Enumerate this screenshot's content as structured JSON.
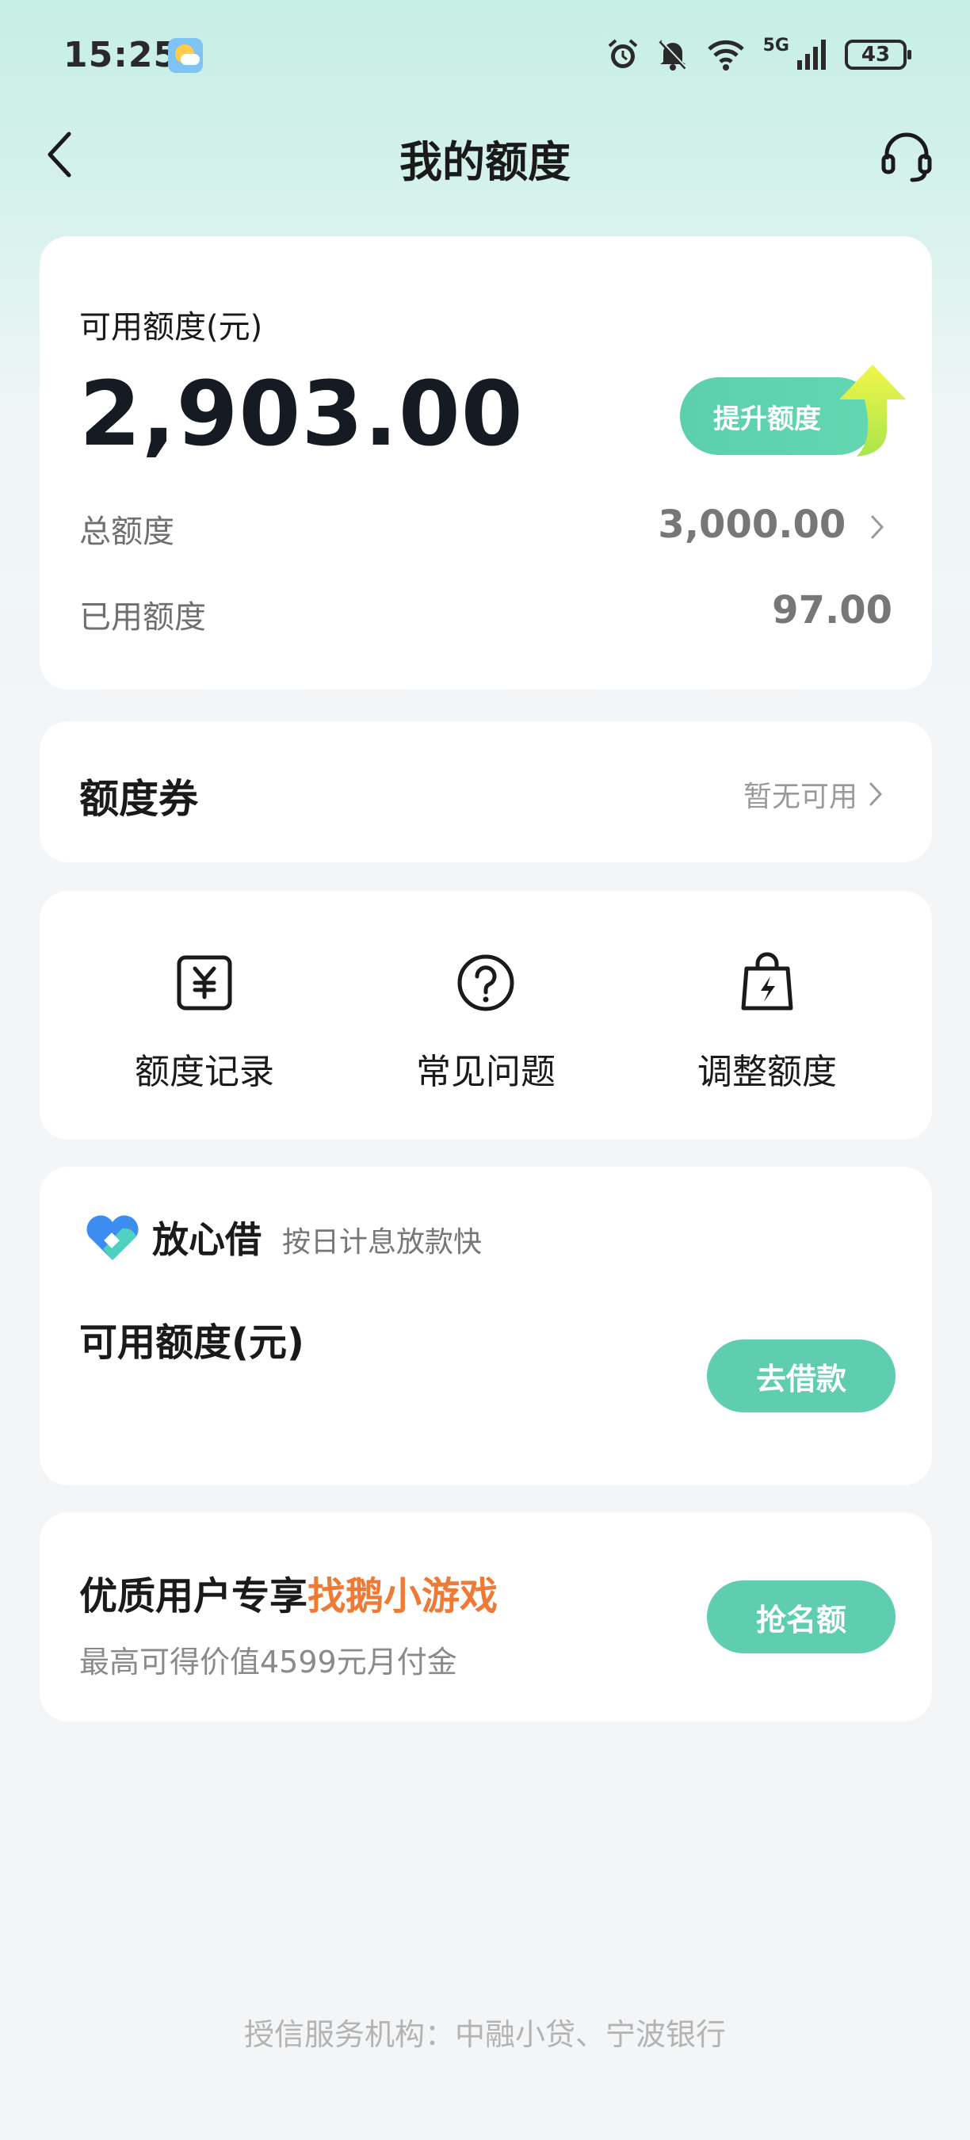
{
  "status_bar": {
    "time": "15:25",
    "weather_icon": "sun-cloud-icon",
    "network": "5G",
    "battery": "43"
  },
  "nav": {
    "title": "我的额度",
    "back_icon": "chevron-left-icon",
    "service_icon": "headset-icon"
  },
  "quota": {
    "label": "可用额度(元)",
    "amount": "2,903.00",
    "raise_button": "提升额度",
    "total_label": "总额度",
    "total_value": "3,000.00",
    "used_label": "已用额度",
    "used_value": "97.00"
  },
  "coupon": {
    "title": "额度券",
    "status": "暂无可用"
  },
  "functions": [
    {
      "label": "额度记录",
      "icon": "yuan-receipt-icon"
    },
    {
      "label": "常见问题",
      "icon": "question-circle-icon"
    },
    {
      "label": "调整额度",
      "icon": "lightning-bag-icon"
    }
  ],
  "loan": {
    "brand": "放心借",
    "slogan": "按日计息放款快",
    "label": "可用额度(元)",
    "button": "去借款"
  },
  "promo": {
    "title_prefix": "优质用户专享",
    "title_highlight": "找鹅小游戏",
    "subtitle": "最高可得价值4599元月付金",
    "button": "抢名额"
  },
  "footer": "授信服务机构：中融小贷、宁波银行",
  "colors": {
    "accent_green": "#5ecdb0",
    "highlight_orange": "#ef7a35",
    "header_gradient_top": "#c6eee5"
  }
}
